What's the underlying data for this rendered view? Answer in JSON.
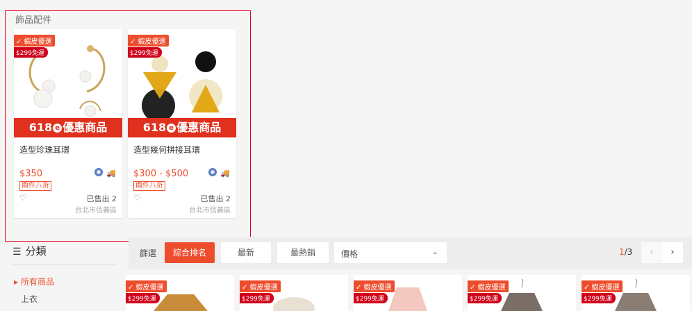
{
  "section": {
    "title": "飾品配件"
  },
  "badges": {
    "preferred": "✓ 蝦皮優選",
    "free_ship": "$299免運"
  },
  "promo_banner": {
    "pre": "618",
    "mark": "e",
    "post": "優惠商品"
  },
  "products": [
    {
      "name": "造型珍珠耳環",
      "price": "$350",
      "discount": "兩件八折",
      "sold": "已售出 2",
      "location": "台北市信義區"
    },
    {
      "name": "造型幾何拼接耳環",
      "price": "$300 - $500",
      "discount": "兩件八折",
      "sold": "已售出 2",
      "location": "台北市信義區"
    }
  ],
  "category": {
    "header": "分類",
    "items": [
      {
        "label": "所有商品"
      },
      {
        "label": "上衣"
      }
    ]
  },
  "sortbar": {
    "label": "篩選",
    "tabs": [
      "綜合排名",
      "最新",
      "最熱銷"
    ],
    "price_label": "價格",
    "page_current": "1",
    "page_total": "/3",
    "prev": "‹",
    "next": "›"
  },
  "colors": {
    "accent": "#ee4d2d",
    "highlight": "#e3001b",
    "banner": "#e0301e"
  },
  "icons": [
    "heart-icon",
    "mall-icon",
    "free-shipping-icon",
    "list-icon",
    "chevron-down-icon"
  ]
}
